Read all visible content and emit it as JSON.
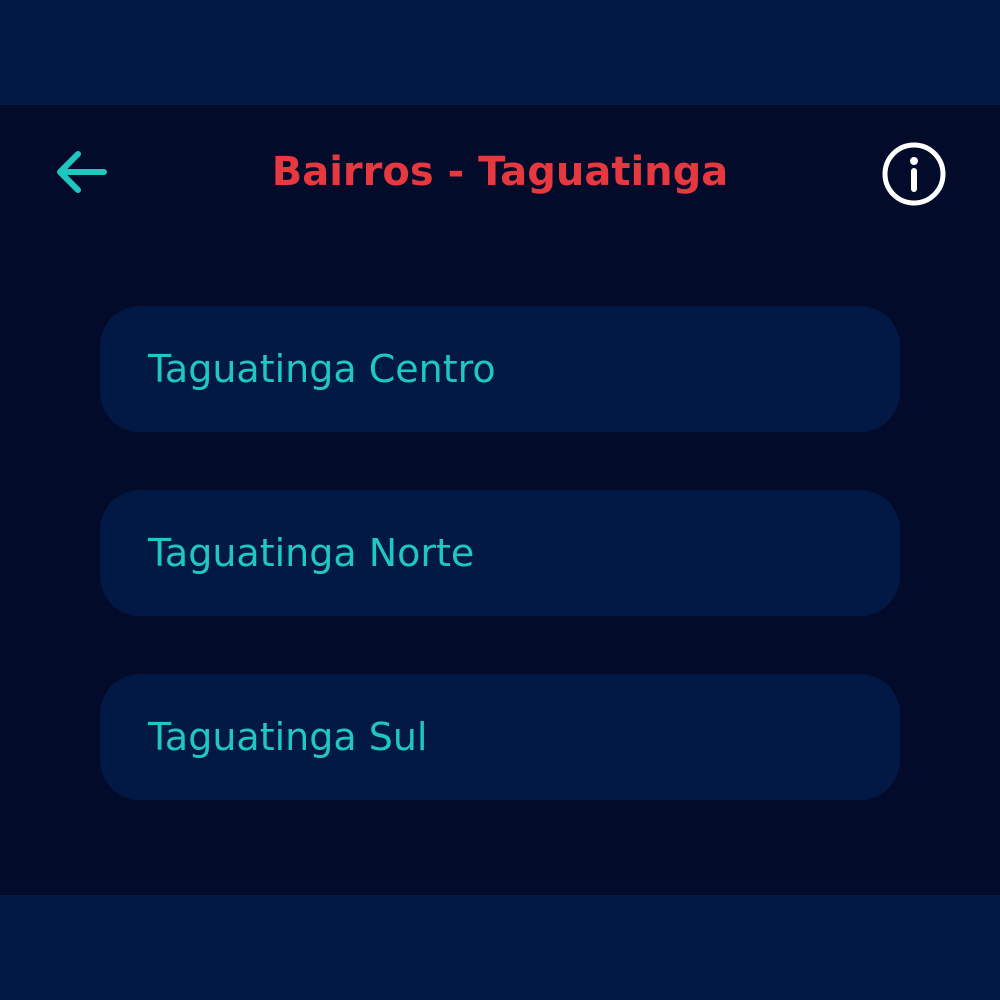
{
  "header": {
    "back_icon": "arrow-left-icon",
    "title": "Bairros - Taguatinga",
    "info_icon": "info-circle-icon"
  },
  "neighborhoods": [
    {
      "label": "Taguatinga Centro"
    },
    {
      "label": "Taguatinga Norte"
    },
    {
      "label": "Taguatinga Sul"
    }
  ],
  "colors": {
    "outer_background": "#021845",
    "panel_background": "#020b2a",
    "card_background": "#021845",
    "accent_teal": "#1ec8c0",
    "title_red": "#e8383f",
    "icon_white": "#ffffff"
  }
}
